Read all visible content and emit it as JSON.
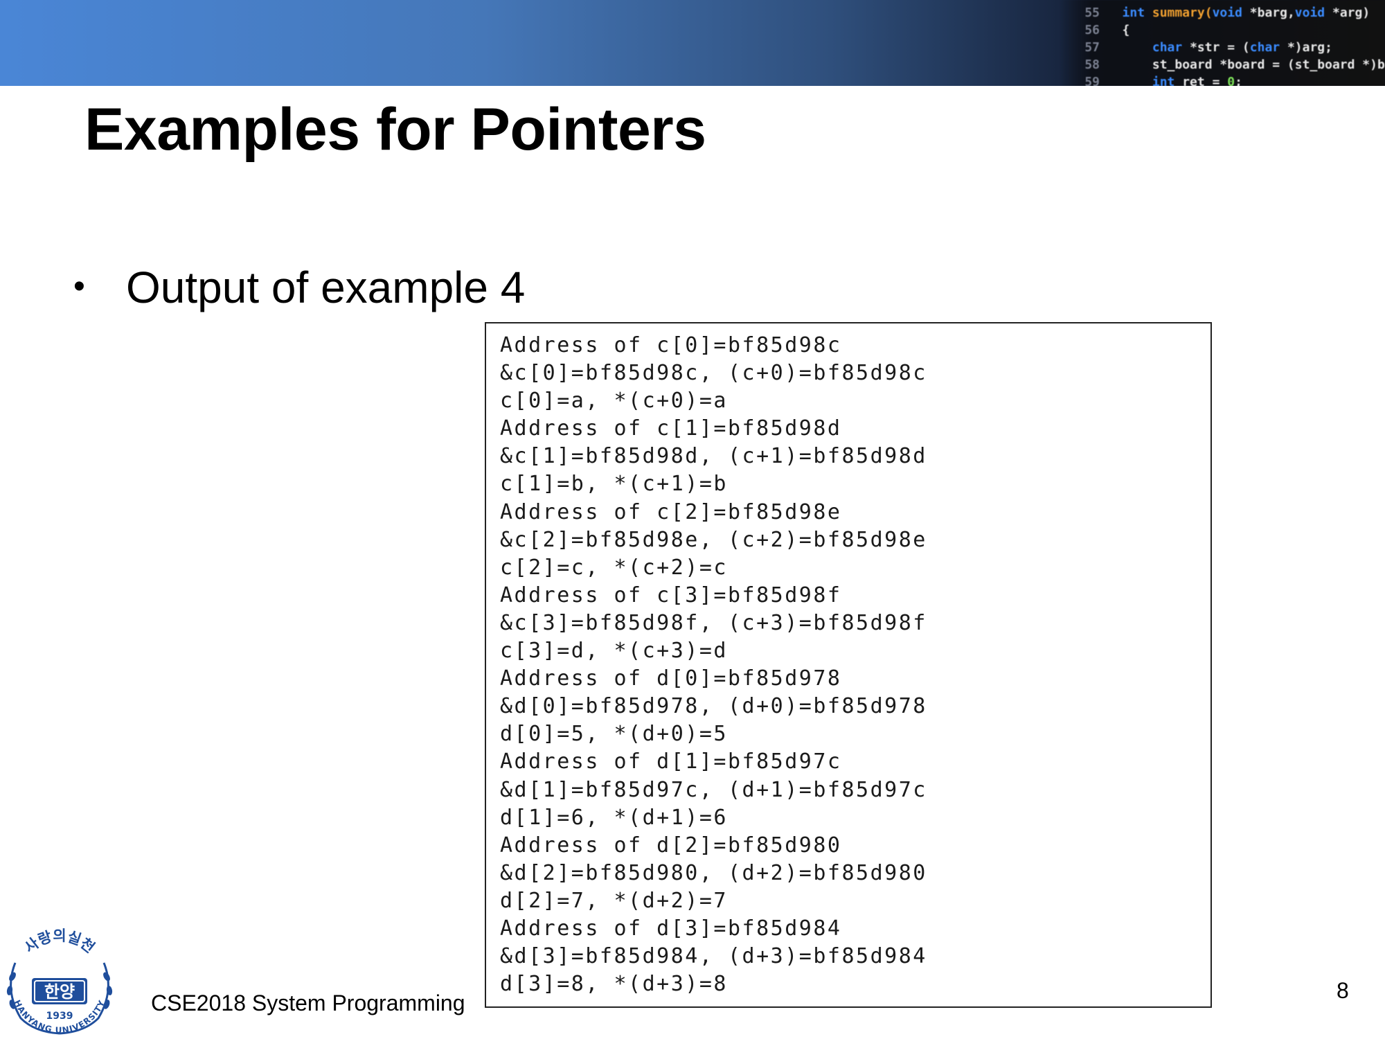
{
  "header": {
    "code_lines": [
      {
        "num": "55",
        "parts": [
          {
            "t": "int ",
            "c": "kw"
          },
          {
            "t": "summary(",
            "c": "fn"
          },
          {
            "t": "void ",
            "c": "kw"
          },
          {
            "t": "*barg,",
            "c": "pl"
          },
          {
            "t": "void ",
            "c": "kw"
          },
          {
            "t": "*arg)",
            "c": "pl"
          }
        ]
      },
      {
        "num": "56",
        "parts": [
          {
            "t": "{",
            "c": "pl"
          }
        ]
      },
      {
        "num": "57",
        "parts": [
          {
            "t": "    char ",
            "c": "kw"
          },
          {
            "t": "*str = (",
            "c": "pl"
          },
          {
            "t": "char ",
            "c": "kw"
          },
          {
            "t": "*)arg;",
            "c": "pl"
          }
        ]
      },
      {
        "num": "58",
        "parts": [
          {
            "t": "    st_board *board = (st_board *)barg;",
            "c": "pl"
          }
        ]
      },
      {
        "num": "59",
        "parts": [
          {
            "t": "    int ",
            "c": "kw"
          },
          {
            "t": "ret = ",
            "c": "pl"
          },
          {
            "t": "0",
            "c": "gn"
          },
          {
            "t": ";",
            "c": "pl"
          }
        ]
      }
    ]
  },
  "slide": {
    "title": "Examples for Pointers",
    "bullet": "Output of example 4"
  },
  "output_lines": [
    "Address of c[0]=bf85d98c",
    "&c[0]=bf85d98c, (c+0)=bf85d98c",
    "c[0]=a, *(c+0)=a",
    "Address of c[1]=bf85d98d",
    "&c[1]=bf85d98d, (c+1)=bf85d98d",
    "c[1]=b, *(c+1)=b",
    "Address of c[2]=bf85d98e",
    "&c[2]=bf85d98e, (c+2)=bf85d98e",
    "c[2]=c, *(c+2)=c",
    "Address of c[3]=bf85d98f",
    "&c[3]=bf85d98f, (c+3)=bf85d98f",
    "c[3]=d, *(c+3)=d",
    "Address of d[0]=bf85d978",
    "&d[0]=bf85d978, (d+0)=bf85d978",
    "d[0]=5, *(d+0)=5",
    "Address of d[1]=bf85d97c",
    "&d[1]=bf85d97c, (d+1)=bf85d97c",
    "d[1]=6, *(d+1)=6",
    "Address of d[2]=bf85d980",
    "&d[2]=bf85d980, (d+2)=bf85d980",
    "d[2]=7, *(d+2)=7",
    "Address of d[3]=bf85d984",
    "&d[3]=bf85d984, (d+3)=bf85d984",
    "d[3]=8, *(d+3)=8"
  ],
  "footer": {
    "course": "CSE2018 System Programming",
    "page": "8"
  },
  "logo": {
    "top_text": "사랑의실천",
    "center_text": "한양",
    "year": "1939",
    "bottom_text": "HANYANG UNIVERSITY"
  },
  "colors": {
    "header_gradient_start": "#4a86d6",
    "header_gradient_end": "#0b0e16",
    "logo_blue": "#1f4e9c"
  }
}
